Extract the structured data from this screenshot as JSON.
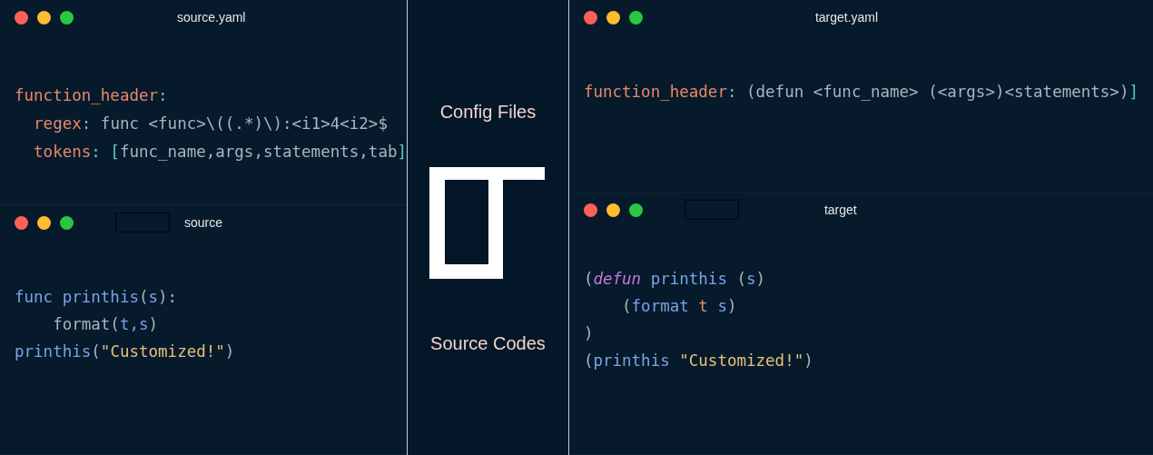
{
  "source_config": {
    "title": "source.yaml",
    "lines": [
      {
        "tokens": [
          {
            "text": "function_header",
            "kind": "key"
          },
          {
            "text": ":",
            "kind": "punct"
          }
        ]
      },
      {
        "tokens": [
          {
            "text": "  regex",
            "kind": "key"
          },
          {
            "text": ":",
            "kind": "punct"
          },
          {
            "text": " func <func>\\((.*)\\):<i1>4<i2>$",
            "kind": "plain"
          }
        ]
      },
      {
        "tokens": [
          {
            "text": "  tokens",
            "kind": "key"
          },
          {
            "text": ": [",
            "kind": "punct"
          },
          {
            "text": "func_name,args,statements,tab",
            "kind": "plain"
          },
          {
            "text": "]",
            "kind": "punct"
          }
        ]
      }
    ]
  },
  "source_code": {
    "title": "source",
    "has_tab_box": true,
    "lines": [
      {
        "tokens": [
          {
            "text": "func printhis",
            "kind": "func"
          },
          {
            "text": "(",
            "kind": "plain"
          },
          {
            "text": "s",
            "kind": "func"
          },
          {
            "text": "):",
            "kind": "plain"
          }
        ]
      },
      {
        "tokens": [
          {
            "text": "    format(",
            "kind": "plain"
          },
          {
            "text": "t,s",
            "kind": "func"
          },
          {
            "text": ")",
            "kind": "plain"
          }
        ]
      },
      {
        "tokens": [
          {
            "text": "printhis",
            "kind": "func"
          },
          {
            "text": "(",
            "kind": "plain"
          },
          {
            "text": "\"Customized!\"",
            "kind": "string"
          },
          {
            "text": ")",
            "kind": "plain"
          }
        ]
      }
    ]
  },
  "center": {
    "top_label": "Config Files",
    "bottom_label": "Source Codes"
  },
  "target_config": {
    "title": "target.yaml",
    "lines": [
      {
        "tokens": [
          {
            "text": "function_header",
            "kind": "key"
          },
          {
            "text": ":",
            "kind": "punct"
          },
          {
            "text": " (defun <func_name> (<args>)<statements>)",
            "kind": "plain"
          },
          {
            "text": "]",
            "kind": "punct"
          }
        ]
      }
    ]
  },
  "target_code": {
    "title": "target",
    "has_tab_box": true,
    "lines": [
      {
        "tokens": [
          {
            "text": "(",
            "kind": "plain"
          },
          {
            "text": "defun",
            "kind": "keyword"
          },
          {
            "text": " printhis ",
            "kind": "func"
          },
          {
            "text": "(",
            "kind": "plain"
          },
          {
            "text": "s",
            "kind": "func"
          },
          {
            "text": ")",
            "kind": "plain"
          }
        ]
      },
      {
        "tokens": [
          {
            "text": "    (",
            "kind": "plain"
          },
          {
            "text": "format ",
            "kind": "func"
          },
          {
            "text": "t",
            "kind": "key"
          },
          {
            "text": " s",
            "kind": "func"
          },
          {
            "text": ")",
            "kind": "plain"
          }
        ]
      },
      {
        "tokens": [
          {
            "text": ")",
            "kind": "plain"
          }
        ]
      },
      {
        "tokens": [
          {
            "text": "(",
            "kind": "plain"
          },
          {
            "text": "printhis ",
            "kind": "func"
          },
          {
            "text": "\"Customized!\"",
            "kind": "string"
          },
          {
            "text": ")",
            "kind": "plain"
          }
        ]
      }
    ]
  }
}
